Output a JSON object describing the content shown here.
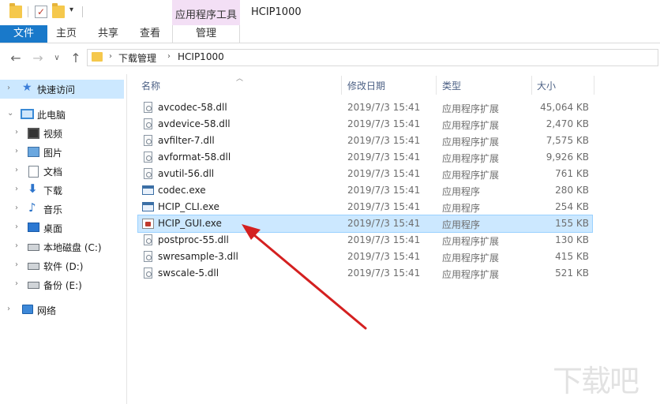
{
  "titlebar": {
    "context_group_label": "应用程序工具",
    "window_title": "HCIP1000"
  },
  "ribbon": {
    "tabs": [
      {
        "label": "文件"
      },
      {
        "label": "主页"
      },
      {
        "label": "共享"
      },
      {
        "label": "查看"
      },
      {
        "label": "管理"
      }
    ]
  },
  "address": {
    "breadcrumb": [
      "下载管理",
      "HCIP1000"
    ]
  },
  "nav": {
    "items": [
      {
        "label": "快速访问",
        "icon": "star-icon"
      },
      {
        "label": "此电脑",
        "icon": "computer-icon"
      },
      {
        "label": "视频",
        "icon": "video-icon"
      },
      {
        "label": "图片",
        "icon": "pictures-icon"
      },
      {
        "label": "文档",
        "icon": "documents-icon"
      },
      {
        "label": "下载",
        "icon": "download-icon"
      },
      {
        "label": "音乐",
        "icon": "music-icon"
      },
      {
        "label": "桌面",
        "icon": "desktop-icon"
      },
      {
        "label": "本地磁盘 (C:)",
        "icon": "drive-icon"
      },
      {
        "label": "软件 (D:)",
        "icon": "drive-icon"
      },
      {
        "label": "备份 (E:)",
        "icon": "drive-icon"
      },
      {
        "label": "网络",
        "icon": "network-icon"
      }
    ]
  },
  "columns": {
    "name": "名称",
    "date": "修改日期",
    "type": "类型",
    "size": "大小"
  },
  "files": [
    {
      "name": "avcodec-58.dll",
      "date": "2019/7/3 15:41",
      "type": "应用程序扩展",
      "size": "45,064 KB"
    },
    {
      "name": "avdevice-58.dll",
      "date": "2019/7/3 15:41",
      "type": "应用程序扩展",
      "size": "2,470 KB"
    },
    {
      "name": "avfilter-7.dll",
      "date": "2019/7/3 15:41",
      "type": "应用程序扩展",
      "size": "7,575 KB"
    },
    {
      "name": "avformat-58.dll",
      "date": "2019/7/3 15:41",
      "type": "应用程序扩展",
      "size": "9,926 KB"
    },
    {
      "name": "avutil-56.dll",
      "date": "2019/7/3 15:41",
      "type": "应用程序扩展",
      "size": "761 KB"
    },
    {
      "name": "codec.exe",
      "date": "2019/7/3 15:41",
      "type": "应用程序",
      "size": "280 KB"
    },
    {
      "name": "HCIP_CLI.exe",
      "date": "2019/7/3 15:41",
      "type": "应用程序",
      "size": "254 KB"
    },
    {
      "name": "HCIP_GUI.exe",
      "date": "2019/7/3 15:41",
      "type": "应用程序",
      "size": "155 KB"
    },
    {
      "name": "postproc-55.dll",
      "date": "2019/7/3 15:41",
      "type": "应用程序扩展",
      "size": "130 KB"
    },
    {
      "name": "swresample-3.dll",
      "date": "2019/7/3 15:41",
      "type": "应用程序扩展",
      "size": "415 KB"
    },
    {
      "name": "swscale-5.dll",
      "date": "2019/7/3 15:41",
      "type": "应用程序扩展",
      "size": "521 KB"
    }
  ],
  "colors": {
    "accent": "#1979ca",
    "selection": "#cce8ff",
    "annotation_arrow": "#d42020"
  }
}
